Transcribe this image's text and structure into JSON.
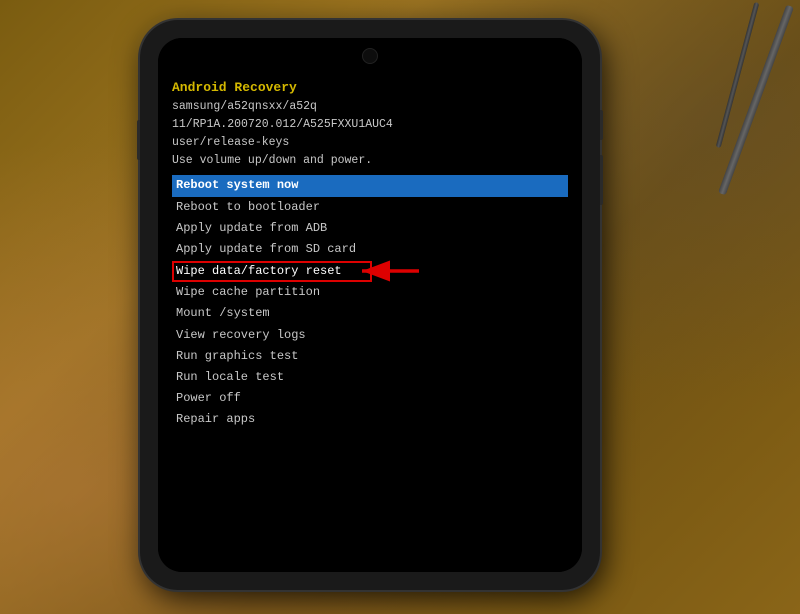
{
  "background": {
    "color": "#7a5c10"
  },
  "phone": {
    "camera_label": "front-camera"
  },
  "recovery": {
    "header": {
      "title": "Android Recovery",
      "line1": "samsung/a52qnsxx/a52q",
      "line2": "11/RP1A.200720.012/A525FXXU1AUC4",
      "line3": "user/release-keys",
      "line4": "Use volume up/down and power."
    },
    "menu_items": [
      {
        "id": "reboot-system",
        "label": "Reboot system now",
        "selected": true
      },
      {
        "id": "reboot-bootloader",
        "label": "Reboot to bootloader",
        "selected": false
      },
      {
        "id": "apply-adb",
        "label": "Apply update from ADB",
        "selected": false
      },
      {
        "id": "apply-sd",
        "label": "Apply update from SD card",
        "selected": false
      },
      {
        "id": "wipe-factory",
        "label": "Wipe data/factory reset",
        "selected": false,
        "highlighted": true
      },
      {
        "id": "wipe-cache",
        "label": "Wipe cache partition",
        "selected": false
      },
      {
        "id": "mount-system",
        "label": "Mount /system",
        "selected": false
      },
      {
        "id": "view-recovery",
        "label": "View recovery logs",
        "selected": false
      },
      {
        "id": "run-graphics",
        "label": "Run graphics test",
        "selected": false
      },
      {
        "id": "run-locale",
        "label": "Run locale test",
        "selected": false
      },
      {
        "id": "power-off",
        "label": "Power off",
        "selected": false
      },
      {
        "id": "repair-apps",
        "label": "Repair apps",
        "selected": false
      }
    ]
  }
}
